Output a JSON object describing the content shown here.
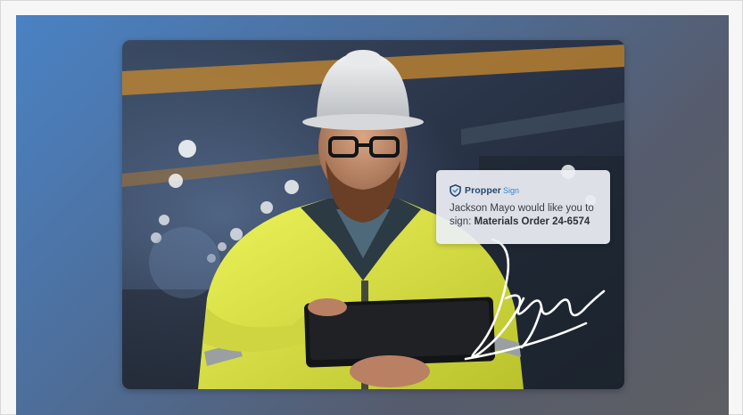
{
  "notification": {
    "brand_name": "Propper",
    "brand_product": "Sign",
    "message_prefix": "Jackson Mayo would like you to sign:",
    "document_name": "Materials Order 24-6574"
  },
  "colors": {
    "background_gradient_start": "#4a82c4",
    "background_gradient_end": "#5e5f63",
    "brand_dark": "#23456f",
    "brand_accent": "#3a86d6",
    "jacket_yellow": "#e3e94a"
  },
  "icons": {
    "brand_logo": "propper-shield-logo-icon"
  }
}
